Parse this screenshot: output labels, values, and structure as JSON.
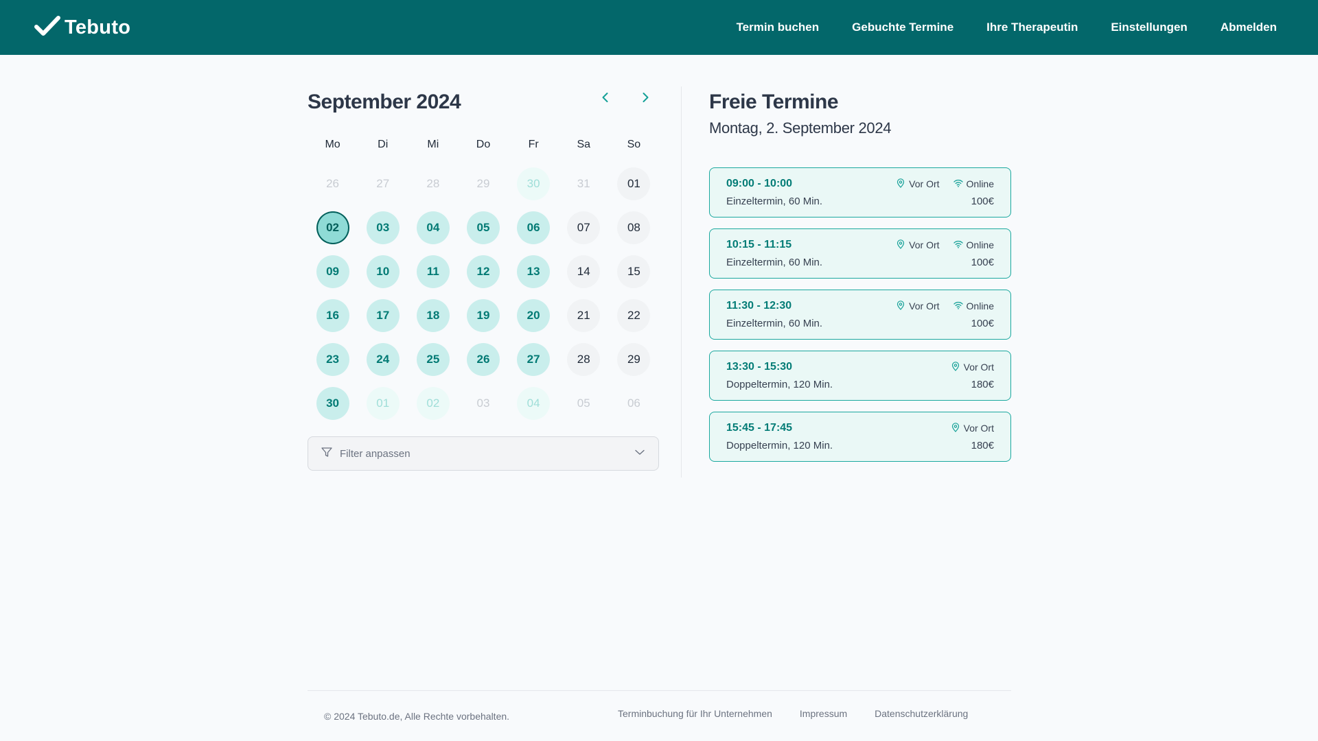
{
  "header": {
    "brand": "Tebuto",
    "logo_icon": "checkmark-icon",
    "nav": [
      {
        "label": "Termin buchen"
      },
      {
        "label": "Gebuchte Termine"
      },
      {
        "label": "Ihre Therapeutin"
      },
      {
        "label": "Einstellungen"
      },
      {
        "label": "Abmelden"
      }
    ]
  },
  "calendar": {
    "title": "September 2024",
    "prev_icon": "chevron-left-icon",
    "next_icon": "chevron-right-icon",
    "weekdays": [
      "Mo",
      "Di",
      "Mi",
      "Do",
      "Fr",
      "Sa",
      "So"
    ],
    "days": [
      {
        "label": "26",
        "state": "muted"
      },
      {
        "label": "27",
        "state": "muted"
      },
      {
        "label": "28",
        "state": "muted"
      },
      {
        "label": "29",
        "state": "muted"
      },
      {
        "label": "30",
        "state": "muted-avail"
      },
      {
        "label": "31",
        "state": "muted"
      },
      {
        "label": "01",
        "state": "plain"
      },
      {
        "label": "02",
        "state": "selected"
      },
      {
        "label": "03",
        "state": "avail"
      },
      {
        "label": "04",
        "state": "avail"
      },
      {
        "label": "05",
        "state": "avail"
      },
      {
        "label": "06",
        "state": "avail"
      },
      {
        "label": "07",
        "state": "plain"
      },
      {
        "label": "08",
        "state": "plain"
      },
      {
        "label": "09",
        "state": "avail"
      },
      {
        "label": "10",
        "state": "avail"
      },
      {
        "label": "11",
        "state": "avail"
      },
      {
        "label": "12",
        "state": "avail"
      },
      {
        "label": "13",
        "state": "avail"
      },
      {
        "label": "14",
        "state": "plain"
      },
      {
        "label": "15",
        "state": "plain"
      },
      {
        "label": "16",
        "state": "avail"
      },
      {
        "label": "17",
        "state": "avail"
      },
      {
        "label": "18",
        "state": "avail"
      },
      {
        "label": "19",
        "state": "avail"
      },
      {
        "label": "20",
        "state": "avail"
      },
      {
        "label": "21",
        "state": "plain"
      },
      {
        "label": "22",
        "state": "plain"
      },
      {
        "label": "23",
        "state": "avail"
      },
      {
        "label": "24",
        "state": "avail"
      },
      {
        "label": "25",
        "state": "avail"
      },
      {
        "label": "26",
        "state": "avail"
      },
      {
        "label": "27",
        "state": "avail"
      },
      {
        "label": "28",
        "state": "plain"
      },
      {
        "label": "29",
        "state": "plain"
      },
      {
        "label": "30",
        "state": "avail"
      },
      {
        "label": "01",
        "state": "muted-avail"
      },
      {
        "label": "02",
        "state": "muted-avail"
      },
      {
        "label": "03",
        "state": "muted"
      },
      {
        "label": "04",
        "state": "muted-avail"
      },
      {
        "label": "05",
        "state": "muted"
      },
      {
        "label": "06",
        "state": "muted"
      }
    ],
    "filter": {
      "label": "Filter anpassen",
      "icon": "funnel-icon",
      "dropdown_icon": "chevron-down-icon"
    }
  },
  "slots": {
    "title": "Freie Termine",
    "date": "Montag, 2. September 2024",
    "items": [
      {
        "time": "09:00 - 10:00",
        "description": "Einzeltermin, 60 Min.",
        "price": "100€",
        "modes": [
          {
            "label": "Vor Ort",
            "icon": "location-pin-icon"
          },
          {
            "label": "Online",
            "icon": "wifi-icon"
          }
        ]
      },
      {
        "time": "10:15 - 11:15",
        "description": "Einzeltermin, 60 Min.",
        "price": "100€",
        "modes": [
          {
            "label": "Vor Ort",
            "icon": "location-pin-icon"
          },
          {
            "label": "Online",
            "icon": "wifi-icon"
          }
        ]
      },
      {
        "time": "11:30 - 12:30",
        "description": "Einzeltermin, 60 Min.",
        "price": "100€",
        "modes": [
          {
            "label": "Vor Ort",
            "icon": "location-pin-icon"
          },
          {
            "label": "Online",
            "icon": "wifi-icon"
          }
        ]
      },
      {
        "time": "13:30 - 15:30",
        "description": "Doppeltermin, 120 Min.",
        "price": "180€",
        "modes": [
          {
            "label": "Vor Ort",
            "icon": "location-pin-icon"
          }
        ]
      },
      {
        "time": "15:45 - 17:45",
        "description": "Doppeltermin, 120 Min.",
        "price": "180€",
        "modes": [
          {
            "label": "Vor Ort",
            "icon": "location-pin-icon"
          }
        ]
      }
    ]
  },
  "footer": {
    "copyright": "© 2024 Tebuto.de, Alle Rechte vorbehalten.",
    "links": [
      {
        "label": "Terminbuchung für Ihr Unternehmen"
      },
      {
        "label": "Impressum"
      },
      {
        "label": "Datenschutzerklärung"
      }
    ]
  },
  "colors": {
    "header_bg": "#03676a",
    "accent": "#037c76",
    "available_bg": "#c9eeec",
    "slot_border": "#1aa89e"
  }
}
